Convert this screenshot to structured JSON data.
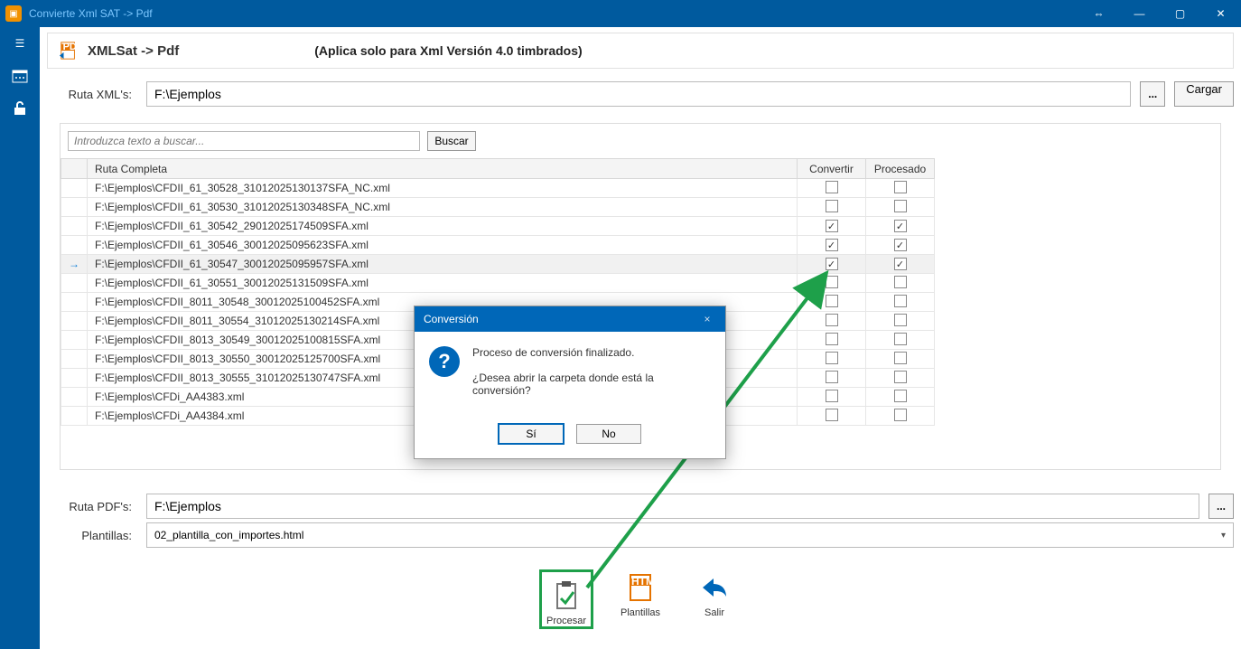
{
  "window": {
    "title": "Convierte Xml SAT -> Pdf"
  },
  "header": {
    "title": "XMLSat -> Pdf",
    "subtitle": "(Aplica solo para Xml Versión 4.0 timbrados)"
  },
  "fields": {
    "ruta_xml_label": "Ruta XML's:",
    "ruta_xml_value": "F:\\Ejemplos",
    "browse": "...",
    "cargar": "Cargar",
    "ruta_pdf_label": "Ruta PDF's:",
    "ruta_pdf_value": "F:\\Ejemplos",
    "plantillas_label": "Plantillas:",
    "plantillas_value": "02_plantilla_con_importes.html"
  },
  "search": {
    "placeholder": "Introduzca texto a buscar...",
    "button": "Buscar"
  },
  "table": {
    "cols": {
      "ruta": "Ruta Completa",
      "convertir": "Convertir",
      "procesado": "Procesado"
    },
    "rows": [
      {
        "path": "F:\\Ejemplos\\CFDII_61_30528_31012025130137SFA_NC.xml",
        "conv": false,
        "proc": false,
        "current": false
      },
      {
        "path": "F:\\Ejemplos\\CFDII_61_30530_31012025130348SFA_NC.xml",
        "conv": false,
        "proc": false,
        "current": false
      },
      {
        "path": "F:\\Ejemplos\\CFDII_61_30542_29012025174509SFA.xml",
        "conv": true,
        "proc": true,
        "current": false
      },
      {
        "path": "F:\\Ejemplos\\CFDII_61_30546_30012025095623SFA.xml",
        "conv": true,
        "proc": true,
        "current": false
      },
      {
        "path": "F:\\Ejemplos\\CFDII_61_30547_30012025095957SFA.xml",
        "conv": true,
        "proc": true,
        "current": true
      },
      {
        "path": "F:\\Ejemplos\\CFDII_61_30551_30012025131509SFA.xml",
        "conv": false,
        "proc": false,
        "current": false
      },
      {
        "path": "F:\\Ejemplos\\CFDII_8011_30548_30012025100452SFA.xml",
        "conv": false,
        "proc": false,
        "current": false
      },
      {
        "path": "F:\\Ejemplos\\CFDII_8011_30554_31012025130214SFA.xml",
        "conv": false,
        "proc": false,
        "current": false
      },
      {
        "path": "F:\\Ejemplos\\CFDII_8013_30549_30012025100815SFA.xml",
        "conv": false,
        "proc": false,
        "current": false
      },
      {
        "path": "F:\\Ejemplos\\CFDII_8013_30550_30012025125700SFA.xml",
        "conv": false,
        "proc": false,
        "current": false
      },
      {
        "path": "F:\\Ejemplos\\CFDII_8013_30555_31012025130747SFA.xml",
        "conv": false,
        "proc": false,
        "current": false
      },
      {
        "path": "F:\\Ejemplos\\CFDi_AA4383.xml",
        "conv": false,
        "proc": false,
        "current": false
      },
      {
        "path": "F:\\Ejemplos\\CFDi_AA4384.xml",
        "conv": false,
        "proc": false,
        "current": false
      }
    ]
  },
  "toolbar": {
    "procesar": "Procesar",
    "plantillas": "Plantillas",
    "salir": "Salir"
  },
  "dialog": {
    "title": "Conversión",
    "line1": "Proceso de conversión finalizado.",
    "line2": "¿Desea abrir la carpeta donde está la conversión?",
    "yes": "Sí",
    "no": "No"
  }
}
